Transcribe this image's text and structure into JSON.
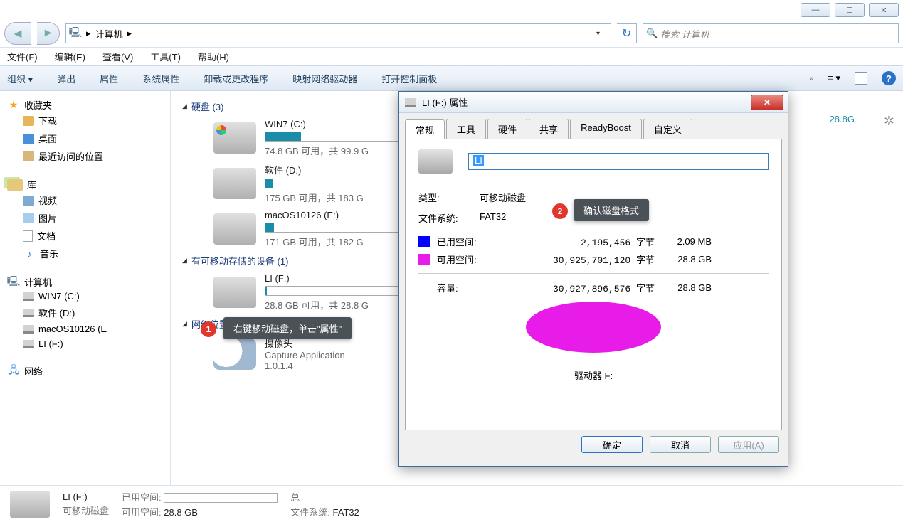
{
  "window": {
    "min": "—",
    "max": "☐",
    "close": "✕"
  },
  "nav": {
    "computer": "计算机",
    "search_placeholder": "搜索 计算机"
  },
  "menu": {
    "file": "文件(F)",
    "edit": "编辑(E)",
    "view": "查看(V)",
    "tools": "工具(T)",
    "help": "帮助(H)"
  },
  "toolbar": {
    "org": "组织",
    "eject": "弹出",
    "props": "属性",
    "sysprops": "系统属性",
    "uninstall": "卸载或更改程序",
    "mapnet": "映射网络驱动器",
    "cpanel": "打开控制面板",
    "help": "?"
  },
  "sidebar": {
    "fav": "收藏夹",
    "downloads": "下载",
    "desktop": "桌面",
    "recent": "最近访问的位置",
    "lib": "库",
    "video": "视频",
    "pictures": "图片",
    "docs": "文档",
    "music": "音乐",
    "computer": "计算机",
    "win7": "WIN7 (C:)",
    "soft": "软件 (D:)",
    "mac": "macOS10126 (E",
    "li": "LI (F:)",
    "net": "网络"
  },
  "content": {
    "hdd_head": "硬盘 (3)",
    "c": {
      "name": "WIN7 (C:)",
      "cap": "74.8 GB 可用，共 99.9 G",
      "pct": 25
    },
    "d": {
      "name": "软件 (D:)",
      "cap": "175 GB 可用，共 183 G",
      "pct": 5
    },
    "e": {
      "name": "macOS10126 (E:)",
      "cap": "171 GB 可用，共 182 G",
      "pct": 6
    },
    "rem_head": "有可移动存储的设备 (1)",
    "f": {
      "name": "LI (F:)",
      "cap": "28.8 GB 可用，共 28.8 G",
      "pct": 1
    },
    "net_head": "网络位置 (1)",
    "cam": {
      "name": "摄像头",
      "sub1": "Capture Application",
      "sub2": "1.0.1.4"
    },
    "free_badge": "28.8G"
  },
  "callouts": {
    "one_num": "1",
    "one_text": "右键移动磁盘，单击\"属性\"",
    "two_num": "2",
    "two_text": "确认磁盘格式"
  },
  "status": {
    "name": "LI (F:)",
    "used_lbl": "已用空间:",
    "free_lbl": "可用空间:",
    "free_val": "28.8 GB",
    "type": "可移动磁盘",
    "total_lbl": "总",
    "fs_lbl": "文件系统:",
    "fs_val": "FAT32"
  },
  "dlg": {
    "title": "LI (F:) 属性",
    "tabs": {
      "general": "常规",
      "tools": "工具",
      "hw": "硬件",
      "share": "共享",
      "rb": "ReadyBoost",
      "custom": "自定义"
    },
    "name_sel": "LI",
    "type_lbl": "类型:",
    "type_val": "可移动磁盘",
    "fs_lbl": "文件系统:",
    "fs_val": "FAT32",
    "used_lbl": "已用空间:",
    "used_bytes": "2,195,456 字节",
    "used_hr": "2.09 MB",
    "free_lbl": "可用空间:",
    "free_bytes": "30,925,701,120 字节",
    "free_hr": "28.8 GB",
    "cap_lbl": "容量:",
    "cap_bytes": "30,927,896,576 字节",
    "cap_hr": "28.8 GB",
    "drive_lbl": "驱动器 F:",
    "ok": "确定",
    "cancel": "取消",
    "apply": "应用(A)"
  }
}
